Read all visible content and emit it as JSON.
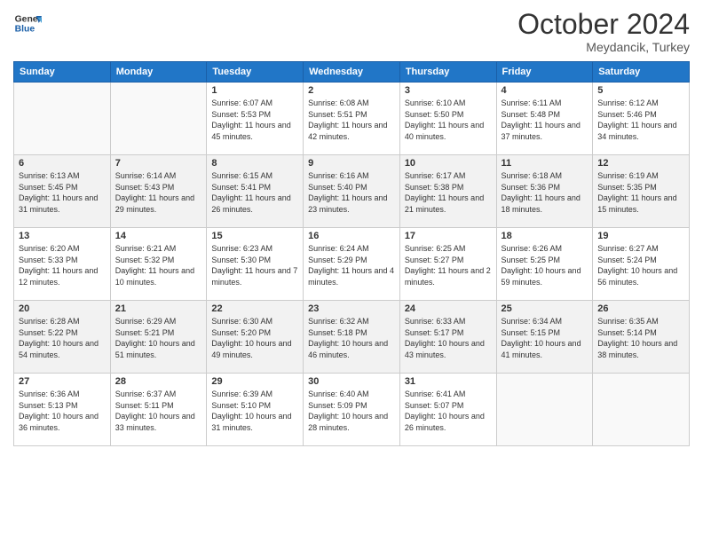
{
  "header": {
    "logo_line1": "General",
    "logo_line2": "Blue",
    "month": "October 2024",
    "location": "Meydancik, Turkey"
  },
  "weekdays": [
    "Sunday",
    "Monday",
    "Tuesday",
    "Wednesday",
    "Thursday",
    "Friday",
    "Saturday"
  ],
  "weeks": [
    [
      {
        "day": "",
        "empty": true
      },
      {
        "day": "",
        "empty": true
      },
      {
        "day": "1",
        "sunrise": "6:07 AM",
        "sunset": "5:53 PM",
        "daylight": "11 hours and 45 minutes."
      },
      {
        "day": "2",
        "sunrise": "6:08 AM",
        "sunset": "5:51 PM",
        "daylight": "11 hours and 42 minutes."
      },
      {
        "day": "3",
        "sunrise": "6:10 AM",
        "sunset": "5:50 PM",
        "daylight": "11 hours and 40 minutes."
      },
      {
        "day": "4",
        "sunrise": "6:11 AM",
        "sunset": "5:48 PM",
        "daylight": "11 hours and 37 minutes."
      },
      {
        "day": "5",
        "sunrise": "6:12 AM",
        "sunset": "5:46 PM",
        "daylight": "11 hours and 34 minutes."
      }
    ],
    [
      {
        "day": "6",
        "sunrise": "6:13 AM",
        "sunset": "5:45 PM",
        "daylight": "11 hours and 31 minutes."
      },
      {
        "day": "7",
        "sunrise": "6:14 AM",
        "sunset": "5:43 PM",
        "daylight": "11 hours and 29 minutes."
      },
      {
        "day": "8",
        "sunrise": "6:15 AM",
        "sunset": "5:41 PM",
        "daylight": "11 hours and 26 minutes."
      },
      {
        "day": "9",
        "sunrise": "6:16 AM",
        "sunset": "5:40 PM",
        "daylight": "11 hours and 23 minutes."
      },
      {
        "day": "10",
        "sunrise": "6:17 AM",
        "sunset": "5:38 PM",
        "daylight": "11 hours and 21 minutes."
      },
      {
        "day": "11",
        "sunrise": "6:18 AM",
        "sunset": "5:36 PM",
        "daylight": "11 hours and 18 minutes."
      },
      {
        "day": "12",
        "sunrise": "6:19 AM",
        "sunset": "5:35 PM",
        "daylight": "11 hours and 15 minutes."
      }
    ],
    [
      {
        "day": "13",
        "sunrise": "6:20 AM",
        "sunset": "5:33 PM",
        "daylight": "11 hours and 12 minutes."
      },
      {
        "day": "14",
        "sunrise": "6:21 AM",
        "sunset": "5:32 PM",
        "daylight": "11 hours and 10 minutes."
      },
      {
        "day": "15",
        "sunrise": "6:23 AM",
        "sunset": "5:30 PM",
        "daylight": "11 hours and 7 minutes."
      },
      {
        "day": "16",
        "sunrise": "6:24 AM",
        "sunset": "5:29 PM",
        "daylight": "11 hours and 4 minutes."
      },
      {
        "day": "17",
        "sunrise": "6:25 AM",
        "sunset": "5:27 PM",
        "daylight": "11 hours and 2 minutes."
      },
      {
        "day": "18",
        "sunrise": "6:26 AM",
        "sunset": "5:25 PM",
        "daylight": "10 hours and 59 minutes."
      },
      {
        "day": "19",
        "sunrise": "6:27 AM",
        "sunset": "5:24 PM",
        "daylight": "10 hours and 56 minutes."
      }
    ],
    [
      {
        "day": "20",
        "sunrise": "6:28 AM",
        "sunset": "5:22 PM",
        "daylight": "10 hours and 54 minutes."
      },
      {
        "day": "21",
        "sunrise": "6:29 AM",
        "sunset": "5:21 PM",
        "daylight": "10 hours and 51 minutes."
      },
      {
        "day": "22",
        "sunrise": "6:30 AM",
        "sunset": "5:20 PM",
        "daylight": "10 hours and 49 minutes."
      },
      {
        "day": "23",
        "sunrise": "6:32 AM",
        "sunset": "5:18 PM",
        "daylight": "10 hours and 46 minutes."
      },
      {
        "day": "24",
        "sunrise": "6:33 AM",
        "sunset": "5:17 PM",
        "daylight": "10 hours and 43 minutes."
      },
      {
        "day": "25",
        "sunrise": "6:34 AM",
        "sunset": "5:15 PM",
        "daylight": "10 hours and 41 minutes."
      },
      {
        "day": "26",
        "sunrise": "6:35 AM",
        "sunset": "5:14 PM",
        "daylight": "10 hours and 38 minutes."
      }
    ],
    [
      {
        "day": "27",
        "sunrise": "6:36 AM",
        "sunset": "5:13 PM",
        "daylight": "10 hours and 36 minutes."
      },
      {
        "day": "28",
        "sunrise": "6:37 AM",
        "sunset": "5:11 PM",
        "daylight": "10 hours and 33 minutes."
      },
      {
        "day": "29",
        "sunrise": "6:39 AM",
        "sunset": "5:10 PM",
        "daylight": "10 hours and 31 minutes."
      },
      {
        "day": "30",
        "sunrise": "6:40 AM",
        "sunset": "5:09 PM",
        "daylight": "10 hours and 28 minutes."
      },
      {
        "day": "31",
        "sunrise": "6:41 AM",
        "sunset": "5:07 PM",
        "daylight": "10 hours and 26 minutes."
      },
      {
        "day": "",
        "empty": true
      },
      {
        "day": "",
        "empty": true
      }
    ]
  ]
}
